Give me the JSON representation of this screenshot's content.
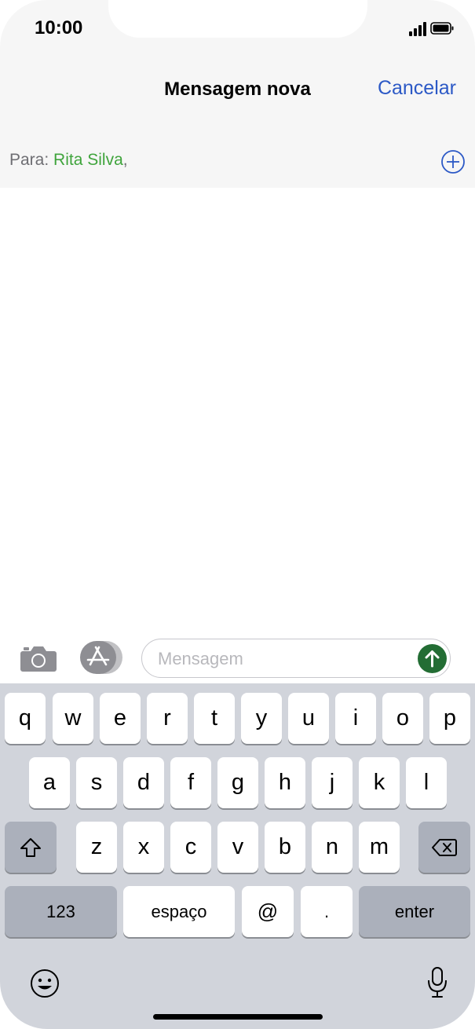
{
  "status_bar": {
    "time": "10:00"
  },
  "nav": {
    "title": "Mensagem nova",
    "cancel_label": "Cancelar"
  },
  "recipients": {
    "label": "Para:",
    "name": "Rita Silva",
    "separator": ","
  },
  "compose": {
    "placeholder": "Mensagem"
  },
  "keyboard": {
    "row1": [
      "q",
      "w",
      "e",
      "r",
      "t",
      "y",
      "u",
      "i",
      "o",
      "p"
    ],
    "row2": [
      "a",
      "s",
      "d",
      "f",
      "g",
      "h",
      "j",
      "k",
      "l"
    ],
    "row3": [
      "z",
      "x",
      "c",
      "v",
      "b",
      "n",
      "m"
    ],
    "row4": {
      "numbers": "123",
      "space": "espaço",
      "at": "@",
      "dot": ".",
      "enter": "enter"
    }
  },
  "icons": {
    "signal": "signal-icon",
    "battery": "battery-icon",
    "add": "plus-circle-icon",
    "camera": "camera-icon",
    "apps": "app-store-icon",
    "send": "send-arrow-icon",
    "shift": "shift-icon",
    "backspace": "backspace-icon",
    "emoji": "emoji-icon",
    "mic": "microphone-icon"
  },
  "colors": {
    "accent": "#2c59c6",
    "recipient": "#3fa43c",
    "send": "#236d34",
    "keyboard_bg": "#d1d4db"
  }
}
